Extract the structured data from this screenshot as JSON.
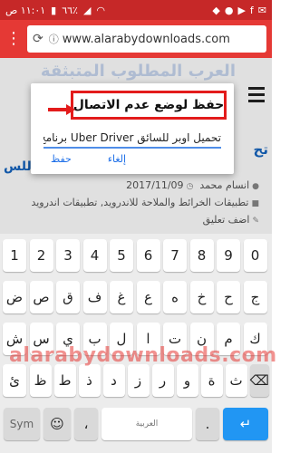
{
  "status_bar": {
    "time": "١١:٠١ ص",
    "battery": "٦٦٪"
  },
  "browser": {
    "url": "www.alarabydownloads.com",
    "tabs_icon": "⋮"
  },
  "page": {
    "faded_heading": "العرب المطلوب المتبثقة",
    "side_title_right": "تح",
    "side_title_right_2": "يبر",
    "side_title_left": "للس",
    "meta_author": "انسام محمد",
    "meta_date": "2017/11/09",
    "meta_categories": "تطبيقات الخرائط والملاحة للاندرويد, تطبيقات اندرويد",
    "meta_comment": "اضف تعليق"
  },
  "dialog": {
    "title": "حفظ لوضع عدم الاتصال",
    "input_value": "تحميل اوبر للسائق Uber Driver برنامج",
    "cancel_label": "إلغاء",
    "save_label": "حفظ"
  },
  "keyboard": {
    "row1": [
      "1",
      "2",
      "3",
      "4",
      "5",
      "6",
      "7",
      "8",
      "9",
      "0"
    ],
    "row2": [
      "ض",
      "ص",
      "ق",
      "ف",
      "غ",
      "ع",
      "ه",
      "خ",
      "ح",
      "ج"
    ],
    "row3": [
      "ش",
      "س",
      "ي",
      "ب",
      "ل",
      "ا",
      "ت",
      "ن",
      "م",
      "ك"
    ],
    "row4": [
      "ظ",
      "ط",
      "ذ",
      "د",
      "ز",
      "ر",
      "و",
      "ة",
      "ث"
    ],
    "row4_extra": "ئ",
    "sym_label": "Sym",
    "space_label": "العربية",
    "comma_label": "،",
    "period_label": ".",
    "enter_icon": "↵"
  },
  "watermark": "alarabydownloads.com",
  "colors": {
    "status_bar": "#c62828",
    "browser_bar": "#e53935",
    "accent": "#1e6fe8",
    "annotation_red": "#e31b1b"
  }
}
